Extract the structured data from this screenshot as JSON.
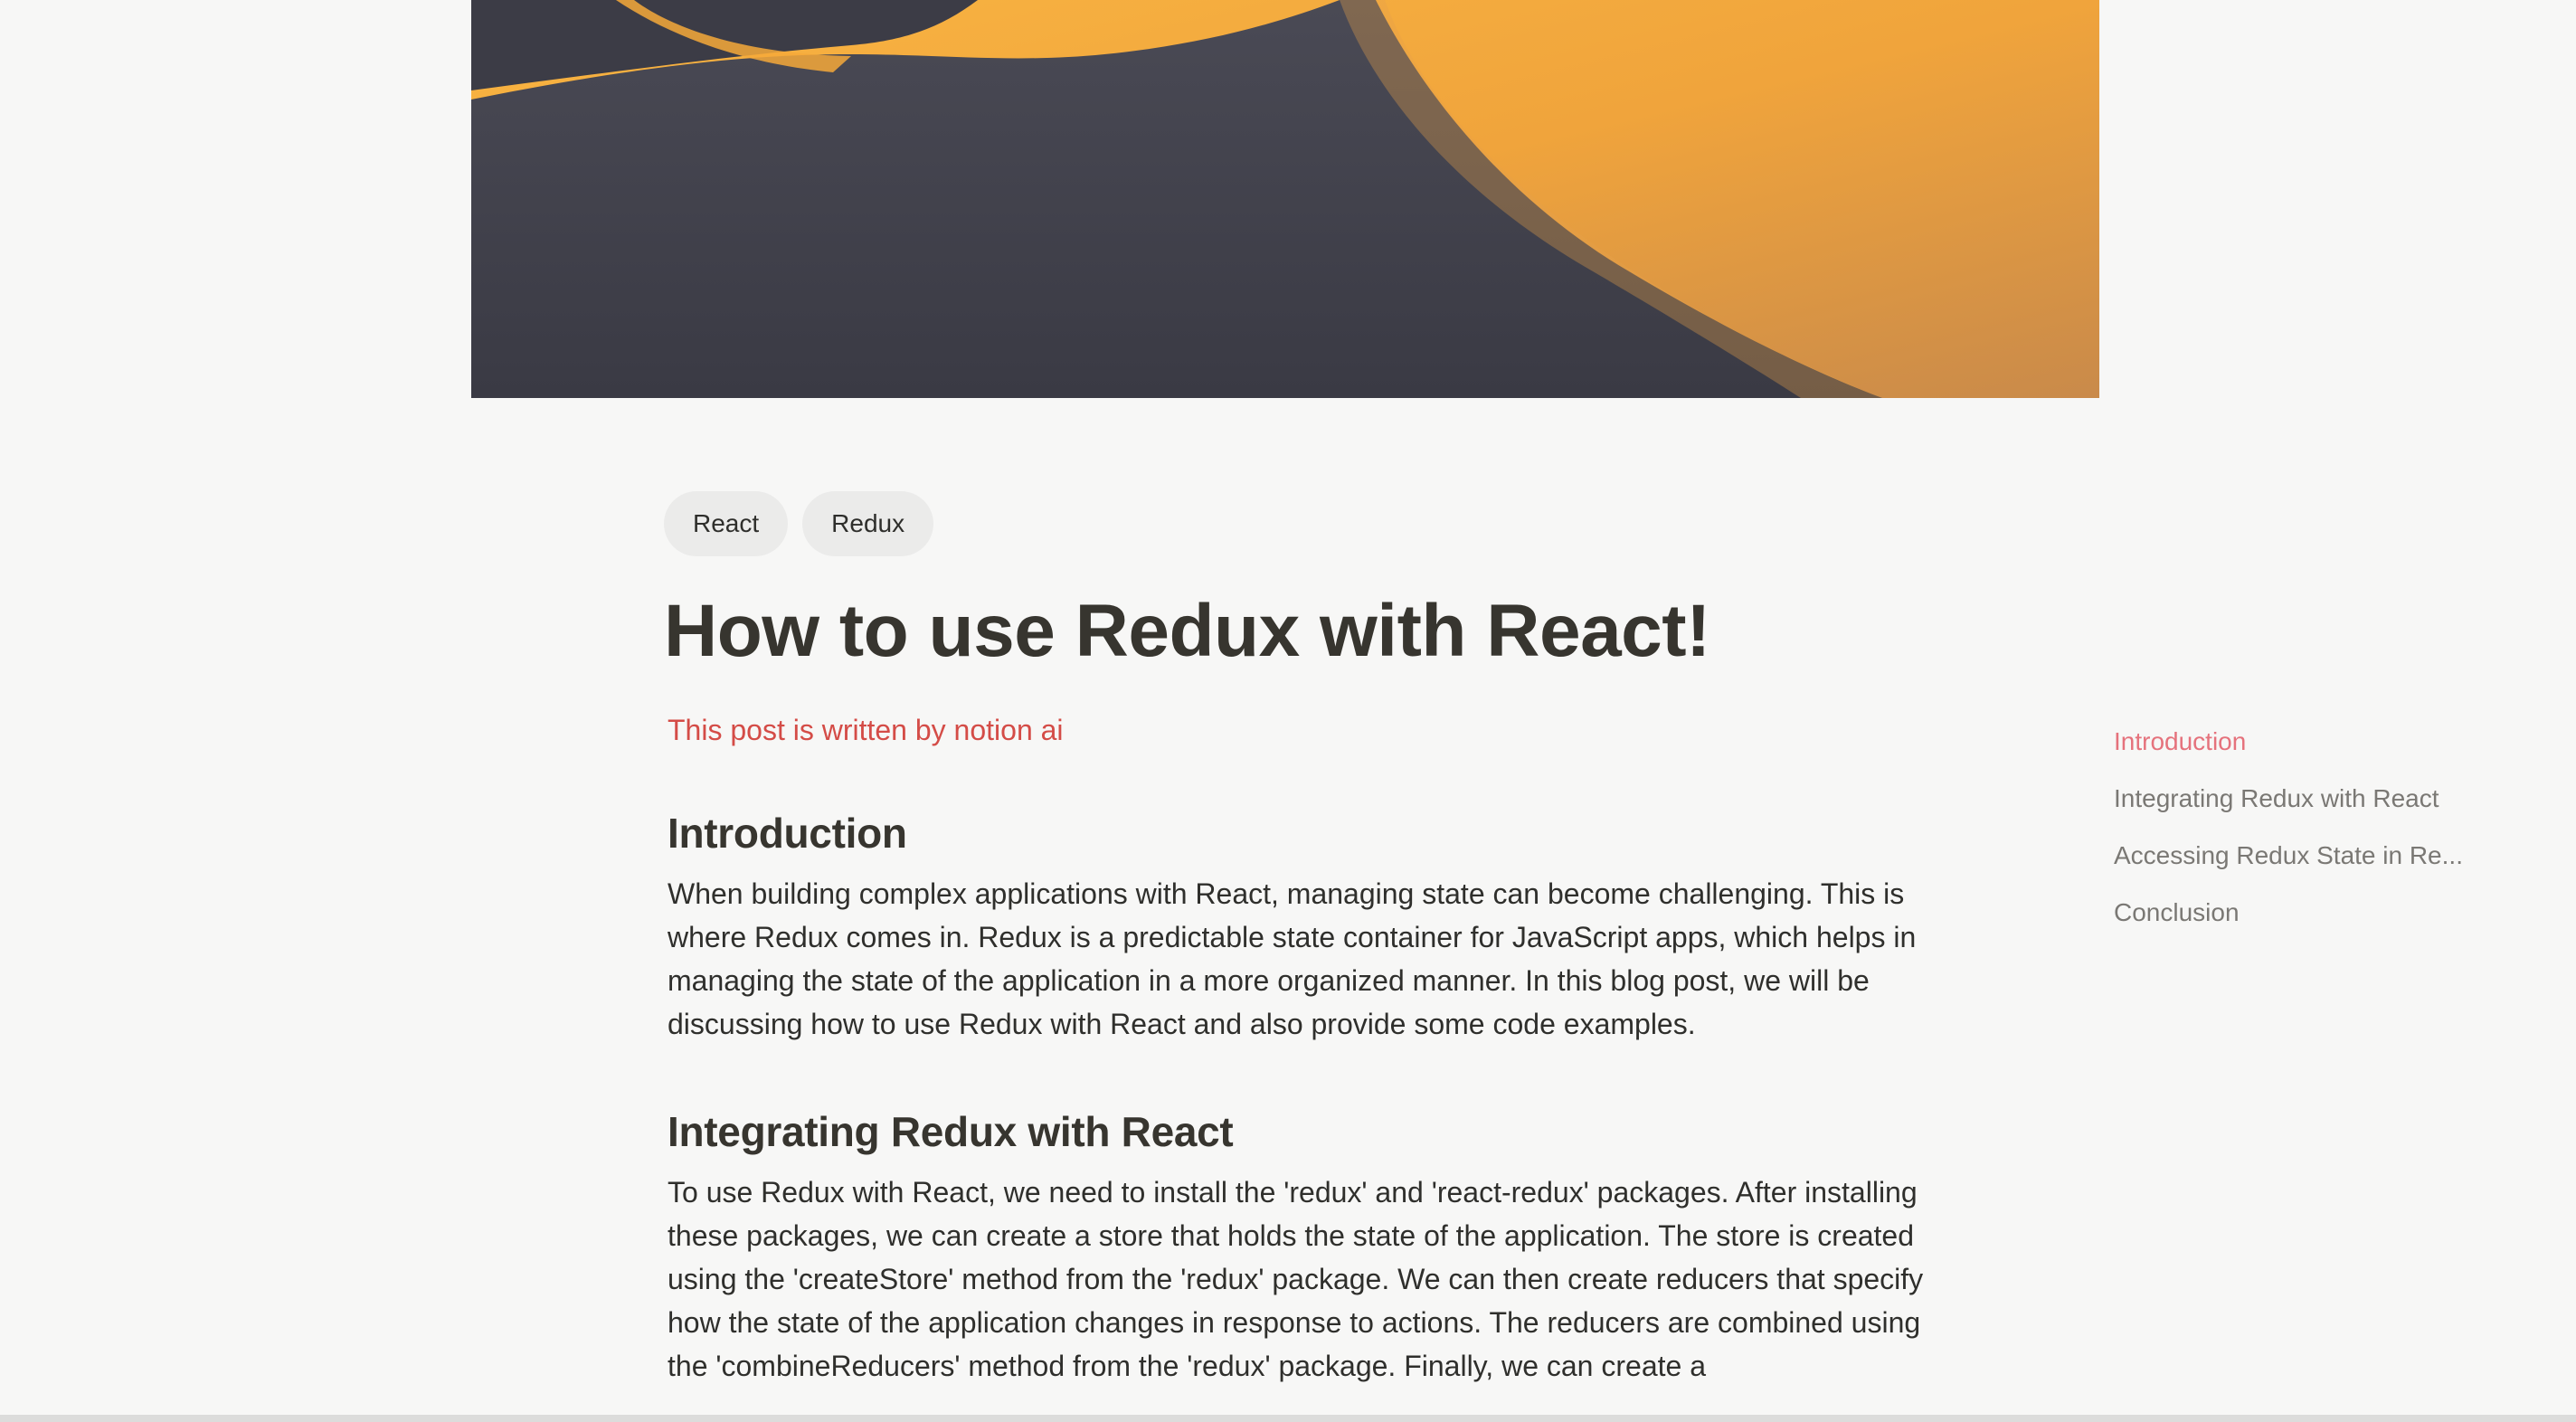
{
  "page": {
    "tags": [
      "React",
      "Redux"
    ],
    "title": "How to use Redux with React!",
    "callout": "This post is written by notion ai"
  },
  "sections": [
    {
      "heading": "Introduction",
      "body": "When building complex applications with React, managing state can become challenging. This is where Redux comes in. Redux is a predictable state container for JavaScript apps, which helps in managing the state of the application in a more organized manner. In this blog post, we will be discussing how to use Redux with React and also provide some code examples."
    },
    {
      "heading": "Integrating Redux with React",
      "body": "To use Redux with React, we need to install the 'redux' and 'react-redux' packages. After installing these packages, we can create a store that holds the state of the application. The store is created using the 'createStore' method from the 'redux' package. We can then create reducers that specify how the state of the application changes in response to actions. The reducers are combined using the 'combineReducers' method from the 'redux' package. Finally, we can create a"
    }
  ],
  "toc": {
    "items": [
      "Introduction",
      "Integrating Redux with React",
      "Accessing Redux State in Re...",
      "Conclusion"
    ],
    "active_index": 0
  },
  "colors": {
    "accent": "#e5727c",
    "callout": "#d44c47",
    "title": "#37352f",
    "background": "#f7f7f6"
  }
}
